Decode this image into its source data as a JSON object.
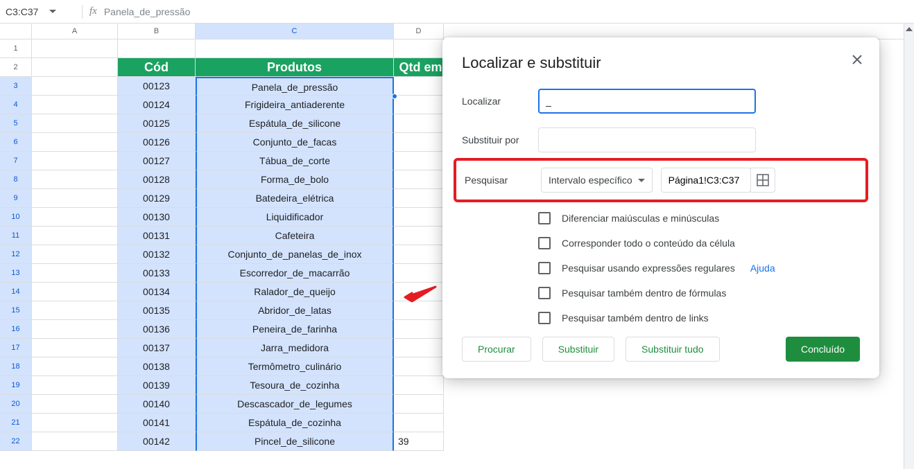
{
  "name_box": "C3:C37",
  "formula_value": "Panela_de_pressão",
  "columns": [
    "A",
    "B",
    "C",
    "D"
  ],
  "selected_col": "C",
  "rows_start": 1,
  "headers_row": {
    "cod": "Cód",
    "produtos": "Produtos",
    "qtd": "Qtd em"
  },
  "data": [
    {
      "n": 3,
      "cod": "00123",
      "prod": "Panela_de_pressão",
      "d": ""
    },
    {
      "n": 4,
      "cod": "00124",
      "prod": "Frigideira_antiaderente",
      "d": ""
    },
    {
      "n": 5,
      "cod": "00125",
      "prod": "Espátula_de_silicone",
      "d": ""
    },
    {
      "n": 6,
      "cod": "00126",
      "prod": "Conjunto_de_facas",
      "d": ""
    },
    {
      "n": 7,
      "cod": "00127",
      "prod": "Tábua_de_corte",
      "d": ""
    },
    {
      "n": 8,
      "cod": "00128",
      "prod": "Forma_de_bolo",
      "d": ""
    },
    {
      "n": 9,
      "cod": "00129",
      "prod": "Batedeira_elétrica",
      "d": ""
    },
    {
      "n": 10,
      "cod": "00130",
      "prod": "Liquidificador",
      "d": ""
    },
    {
      "n": 11,
      "cod": "00131",
      "prod": "Cafeteira",
      "d": ""
    },
    {
      "n": 12,
      "cod": "00132",
      "prod": "Conjunto_de_panelas_de_inox",
      "d": ""
    },
    {
      "n": 13,
      "cod": "00133",
      "prod": "Escorredor_de_macarrão",
      "d": ""
    },
    {
      "n": 14,
      "cod": "00134",
      "prod": "Ralador_de_queijo",
      "d": ""
    },
    {
      "n": 15,
      "cod": "00135",
      "prod": "Abridor_de_latas",
      "d": ""
    },
    {
      "n": 16,
      "cod": "00136",
      "prod": "Peneira_de_farinha",
      "d": ""
    },
    {
      "n": 17,
      "cod": "00137",
      "prod": "Jarra_medidora",
      "d": ""
    },
    {
      "n": 18,
      "cod": "00138",
      "prod": "Termômetro_culinário",
      "d": ""
    },
    {
      "n": 19,
      "cod": "00139",
      "prod": "Tesoura_de_cozinha",
      "d": ""
    },
    {
      "n": 20,
      "cod": "00140",
      "prod": "Descascador_de_legumes",
      "d": ""
    },
    {
      "n": 21,
      "cod": "00141",
      "prod": "Espátula_de_cozinha",
      "d": ""
    },
    {
      "n": 22,
      "cod": "00142",
      "prod": "Pincel_de_silicone",
      "d": "39"
    }
  ],
  "dialog": {
    "title": "Localizar e substituir",
    "find_label": "Localizar",
    "find_value": "_",
    "replace_label": "Substituir por",
    "replace_value": "",
    "search_label": "Pesquisar",
    "search_scope": "Intervalo específico",
    "search_range": "Página1!C3:C37",
    "opts": {
      "case": "Diferenciar maiúsculas e minúsculas",
      "entire": "Corresponder todo o conteúdo da célula",
      "regex": "Pesquisar usando expressões regulares",
      "help": "Ajuda",
      "formulas": "Pesquisar também dentro de fórmulas",
      "links": "Pesquisar também dentro de links"
    },
    "btn_find": "Procurar",
    "btn_replace": "Substituir",
    "btn_replace_all": "Substituir tudo",
    "btn_done": "Concluído"
  }
}
